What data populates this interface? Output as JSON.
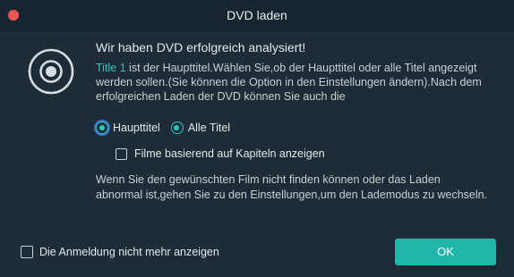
{
  "window": {
    "title": "DVD laden"
  },
  "content": {
    "heading": "Wir haben DVD erfolgreich analysiert!",
    "title_highlight": "Title 1",
    "description_rest": " ist der Haupttitel.Wählen Sie,ob der Haupttitel oder alle Titel angezeigt werden sollen.(Sie können die Option in den Einstellungen ändern).Nach dem erfolgreichen Laden der DVD können Sie auch die",
    "radio_options": [
      {
        "label": "Haupttitel",
        "selected": true
      },
      {
        "label": "Alle Titel",
        "selected": true
      }
    ],
    "chapter_checkbox_label": "Filme basierend auf Kapiteln anzeigen",
    "chapter_checked": false,
    "info_text": "Wenn Sie den gewünschten Film nicht finden können oder das Laden abnormal ist,gehen Sie zu den Einstellungen,um den Lademodus zu wechseln."
  },
  "footer": {
    "dont_show_label": "Die Anmeldung nicht mehr anzeigen",
    "dont_show_checked": false,
    "ok_label": "OK"
  },
  "colors": {
    "accent": "#1eb6a8",
    "highlight": "#2cc7c0",
    "background": "#1d2c37",
    "close": "#f05553"
  },
  "icons": {
    "close": "close-icon",
    "disc": "disc-icon"
  }
}
